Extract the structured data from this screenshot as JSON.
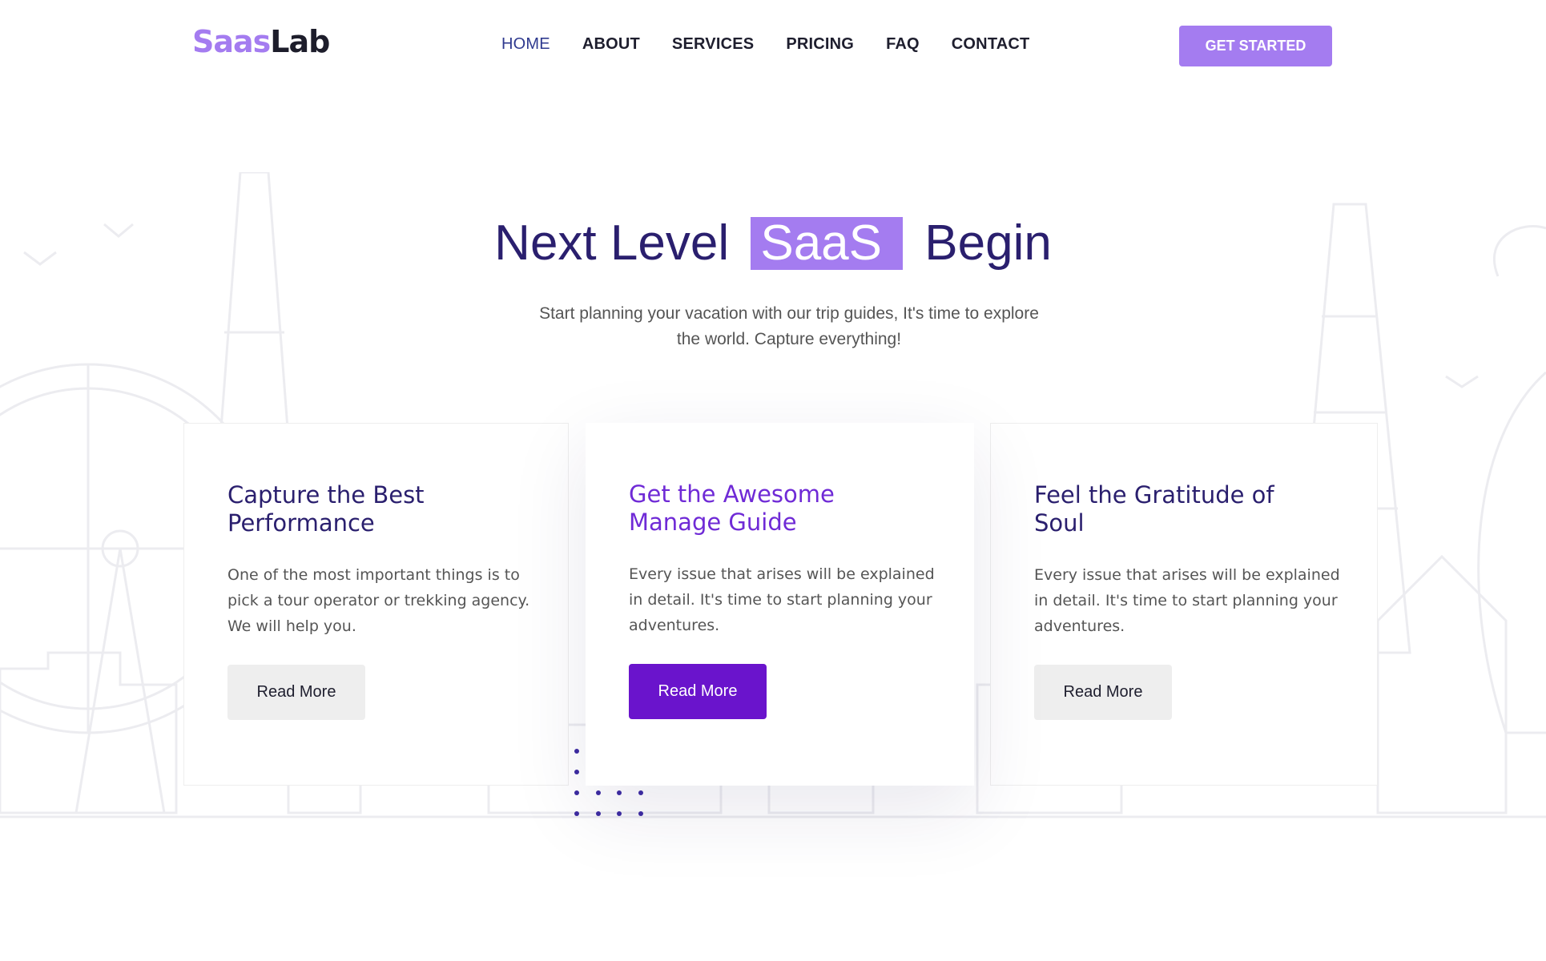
{
  "brand": {
    "part1": "Saas",
    "part2": "Lab"
  },
  "nav": [
    {
      "label": "HOME",
      "active": true
    },
    {
      "label": "ABOUT"
    },
    {
      "label": "SERVICES"
    },
    {
      "label": "PRICING"
    },
    {
      "label": "FAQ"
    },
    {
      "label": "CONTACT"
    }
  ],
  "cta": {
    "label": "GET STARTED"
  },
  "hero": {
    "title_before": "Next Level",
    "title_highlight": "SaaS",
    "title_after": "Begin",
    "subtitle_line1": "Start planning your vacation with our trip guides, It's time to explore",
    "subtitle_line2": "the world. Capture everything!"
  },
  "cards": [
    {
      "title": "Capture the Best Performance",
      "text": "One of the most important things is to pick a tour operator or trekking agency. We will help you.",
      "button": "Read More"
    },
    {
      "title": "Get the Awesome Manage Guide",
      "text": "Every issue that arises will be explained in detail. It's time to start planning your adventures.",
      "button": "Read More"
    },
    {
      "title": "Feel the Gratitude of Soul",
      "text": "Every issue that arises will be explained in detail. It's time to start planning your adventures.",
      "button": "Read More"
    }
  ],
  "colors": {
    "brand_purple": "#a47cf0",
    "deep_purple": "#6a14cc",
    "heading_navy": "#2a1f6e"
  }
}
